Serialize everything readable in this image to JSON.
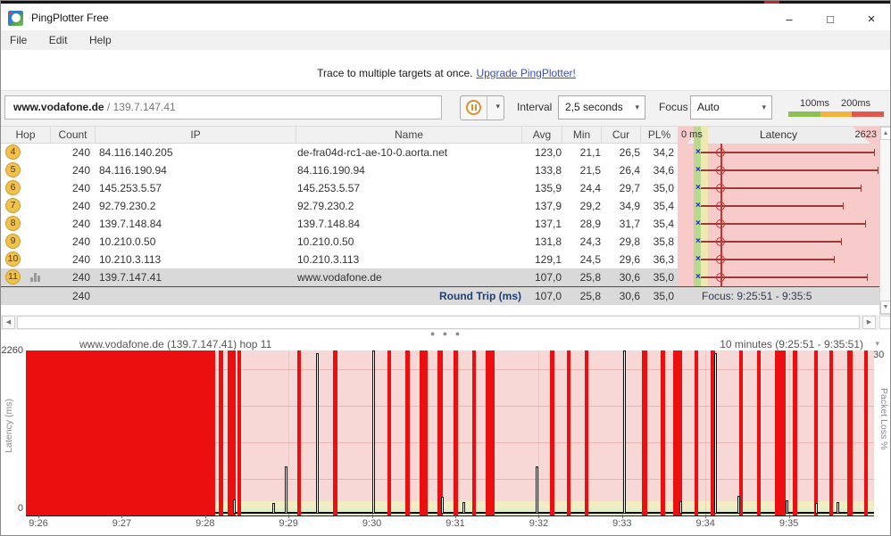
{
  "window": {
    "title": "PingPlotter Free",
    "minimize_glyph": "–",
    "maximize_glyph": "□",
    "close_glyph": "×"
  },
  "menu": {
    "items": [
      "File",
      "Edit",
      "Help"
    ]
  },
  "banner": {
    "text": "Trace to multiple targets at once.",
    "link_label": "Upgrade PingPlotter!"
  },
  "toolbar": {
    "target_host": "www.vodafone.de",
    "target_sep": " / ",
    "target_ip": "139.7.147.41",
    "pause_arrow": "▾",
    "interval_label": "Interval",
    "interval_value": "2,5 seconds",
    "focus_label": "Focus",
    "focus_value": "Auto",
    "dropdown_arrow": "▾",
    "legend": {
      "label_100": "100ms",
      "label_200": "200ms",
      "colors": [
        "#8cc152",
        "#f3b33d",
        "#e4574e"
      ]
    }
  },
  "table": {
    "headers": {
      "hop": "Hop",
      "count": "Count",
      "ip": "IP",
      "name": "Name",
      "avg": "Avg",
      "min": "Min",
      "cur": "Cur",
      "pl": "PL%",
      "zero_ms": "0 ms",
      "latency": "Latency",
      "max_scale": "2623"
    },
    "rows": [
      {
        "hop": "4",
        "count": "240",
        "ip": "84.116.140.205",
        "name": "de-fra04d-rc1-ae-10-0.aorta.net",
        "avg": "123,0",
        "min": "21,1",
        "cur": "26,5",
        "pl": "34,2",
        "bar_end": 220,
        "selected": false
      },
      {
        "hop": "5",
        "count": "240",
        "ip": "84.116.190.94",
        "name": "84.116.190.94",
        "avg": "133,8",
        "min": "21,5",
        "cur": "26,4",
        "pl": "34,6",
        "bar_end": 224,
        "selected": false
      },
      {
        "hop": "6",
        "count": "240",
        "ip": "145.253.5.57",
        "name": "145.253.5.57",
        "avg": "135,9",
        "min": "24,4",
        "cur": "29,7",
        "pl": "35,0",
        "bar_end": 205,
        "selected": false
      },
      {
        "hop": "7",
        "count": "240",
        "ip": "92.79.230.2",
        "name": "92.79.230.2",
        "avg": "137,9",
        "min": "29,2",
        "cur": "34,9",
        "pl": "35,4",
        "bar_end": 185,
        "selected": false
      },
      {
        "hop": "8",
        "count": "240",
        "ip": "139.7.148.84",
        "name": "139.7.148.84",
        "avg": "137,1",
        "min": "28,9",
        "cur": "31,7",
        "pl": "35,4",
        "bar_end": 210,
        "selected": false
      },
      {
        "hop": "9",
        "count": "240",
        "ip": "10.210.0.50",
        "name": "10.210.0.50",
        "avg": "131,8",
        "min": "24,3",
        "cur": "29,8",
        "pl": "35,8",
        "bar_end": 183,
        "selected": false
      },
      {
        "hop": "10",
        "count": "240",
        "ip": "10.210.3.113",
        "name": "10.210.3.113",
        "avg": "129,1",
        "min": "24,5",
        "cur": "29,6",
        "pl": "36,3",
        "bar_end": 175,
        "selected": false
      },
      {
        "hop": "11",
        "count": "240",
        "ip": "139.7.147.41",
        "name": "www.vodafone.de",
        "avg": "107,0",
        "min": "25,8",
        "cur": "30,6",
        "pl": "35,0",
        "bar_end": 212,
        "selected": true
      }
    ],
    "summary": {
      "count": "240",
      "label": "Round Trip (ms)",
      "avg": "107,0",
      "min": "25,8",
      "cur": "30,6",
      "pl": "35,0",
      "focus": "Focus: 9:25:51 - 9:35:5"
    }
  },
  "chart_data": {
    "type": "line",
    "title": "www.vodafone.de (139.7.147.41) hop 11",
    "timeframe_label": "10 minutes (9:25:51 - 9:35:51)",
    "ylabel_left": "Latency (ms)",
    "ylim_left": [
      0,
      2260
    ],
    "ylabel_right": "Packet Loss %",
    "ylim_right": [
      0,
      30
    ],
    "y_top_label": "2260",
    "y_bottom_label": "0",
    "y_right_top_label": "30",
    "duration_seconds": 600,
    "x_ticks": [
      "9:26",
      "9:27",
      "9:28",
      "9:29",
      "9:30",
      "9:31",
      "9:32",
      "9:33",
      "9:34",
      "9:35"
    ],
    "x_tick_first_offset_s": 9,
    "x_tick_interval_s": 60,
    "latency_baseline_ms": 30,
    "packet_loss_solid": {
      "start_s": 0,
      "end_s": 136
    },
    "packet_loss_bars_s": [
      [
        139,
        3
      ],
      [
        145,
        6
      ],
      [
        152,
        3
      ],
      [
        195,
        3
      ],
      [
        221,
        3
      ],
      [
        260,
        3
      ],
      [
        273,
        3
      ],
      [
        283,
        6
      ],
      [
        296,
        4
      ],
      [
        308,
        3
      ],
      [
        321,
        3
      ],
      [
        331,
        6
      ],
      [
        377,
        3
      ],
      [
        389,
        3
      ],
      [
        402,
        3
      ],
      [
        443,
        4
      ],
      [
        457,
        3
      ],
      [
        466,
        6
      ],
      [
        481,
        3
      ],
      [
        493,
        3
      ],
      [
        513,
        3
      ],
      [
        526,
        3
      ],
      [
        539,
        8
      ],
      [
        552,
        3
      ],
      [
        567,
        3
      ],
      [
        578,
        3
      ],
      [
        591,
        4
      ],
      [
        603,
        3
      ]
    ],
    "latency_spikes": [
      [
        149,
        200
      ],
      [
        177,
        150
      ],
      [
        186,
        650
      ],
      [
        209,
        2200
      ],
      [
        249,
        2230
      ],
      [
        299,
        230
      ],
      [
        314,
        160
      ],
      [
        367,
        650
      ],
      [
        430,
        2230
      ],
      [
        470,
        170
      ],
      [
        495,
        2200
      ],
      [
        512,
        250
      ],
      [
        547,
        180
      ],
      [
        568,
        150
      ],
      [
        583,
        160
      ]
    ]
  }
}
